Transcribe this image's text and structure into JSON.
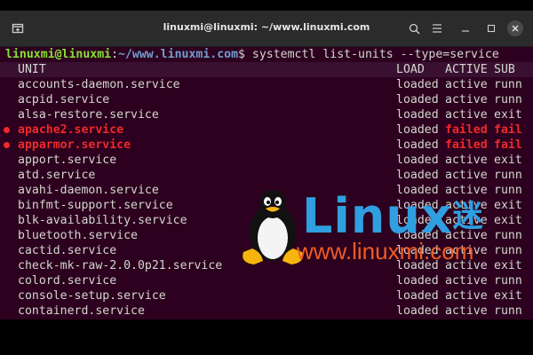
{
  "titlebar": {
    "title": "linuxmi@linuxmi: ~/www.linuxmi.com",
    "icons": [
      "new-tab-icon",
      "search-icon",
      "hamburger-menu-icon",
      "minimize-icon",
      "maximize-icon",
      "close-icon"
    ]
  },
  "prompt": {
    "user_host": "linuxmi@linuxmi",
    "colon": ":",
    "path": "~/www.linuxmi.com",
    "symbol": "$ ",
    "command": "systemctl list-units --type=service"
  },
  "table": {
    "headers": {
      "unit": "UNIT",
      "load": "LOAD",
      "active": "ACTIVE",
      "sub": "SUB"
    },
    "rows": [
      {
        "unit": "accounts-daemon.service",
        "load": "loaded",
        "active": "active",
        "sub": "runn",
        "failed": false
      },
      {
        "unit": "acpid.service",
        "load": "loaded",
        "active": "active",
        "sub": "runn",
        "failed": false
      },
      {
        "unit": "alsa-restore.service",
        "load": "loaded",
        "active": "active",
        "sub": "exit",
        "failed": false
      },
      {
        "unit": "apache2.service",
        "load": "loaded",
        "active": "failed",
        "sub": "fail",
        "failed": true
      },
      {
        "unit": "apparmor.service",
        "load": "loaded",
        "active": "failed",
        "sub": "fail",
        "failed": true
      },
      {
        "unit": "apport.service",
        "load": "loaded",
        "active": "active",
        "sub": "exit",
        "failed": false
      },
      {
        "unit": "atd.service",
        "load": "loaded",
        "active": "active",
        "sub": "runn",
        "failed": false
      },
      {
        "unit": "avahi-daemon.service",
        "load": "loaded",
        "active": "active",
        "sub": "runn",
        "failed": false
      },
      {
        "unit": "binfmt-support.service",
        "load": "loaded",
        "active": "active",
        "sub": "exit",
        "failed": false
      },
      {
        "unit": "blk-availability.service",
        "load": "loaded",
        "active": "active",
        "sub": "exit",
        "failed": false
      },
      {
        "unit": "bluetooth.service",
        "load": "loaded",
        "active": "active",
        "sub": "runn",
        "failed": false
      },
      {
        "unit": "cactid.service",
        "load": "loaded",
        "active": "active",
        "sub": "runn",
        "failed": false
      },
      {
        "unit": "check-mk-raw-2.0.0p21.service",
        "load": "loaded",
        "active": "active",
        "sub": "exit",
        "failed": false
      },
      {
        "unit": "colord.service",
        "load": "loaded",
        "active": "active",
        "sub": "runn",
        "failed": false
      },
      {
        "unit": "console-setup.service",
        "load": "loaded",
        "active": "active",
        "sub": "exit",
        "failed": false
      },
      {
        "unit": "containerd.service",
        "load": "loaded",
        "active": "active",
        "sub": "runn",
        "failed": false
      }
    ]
  },
  "watermark": {
    "logo_text": "Linux",
    "logo_suffix": "迷",
    "url": "www.linuxmi.com",
    "colors": {
      "blue": "#2f9fe0",
      "orange": "#ef5b25"
    }
  },
  "colors": {
    "terminal_bg": "#2c001e",
    "prompt_green": "#8ae234",
    "prompt_blue": "#729fcf",
    "failed_red": "#ef2929"
  }
}
